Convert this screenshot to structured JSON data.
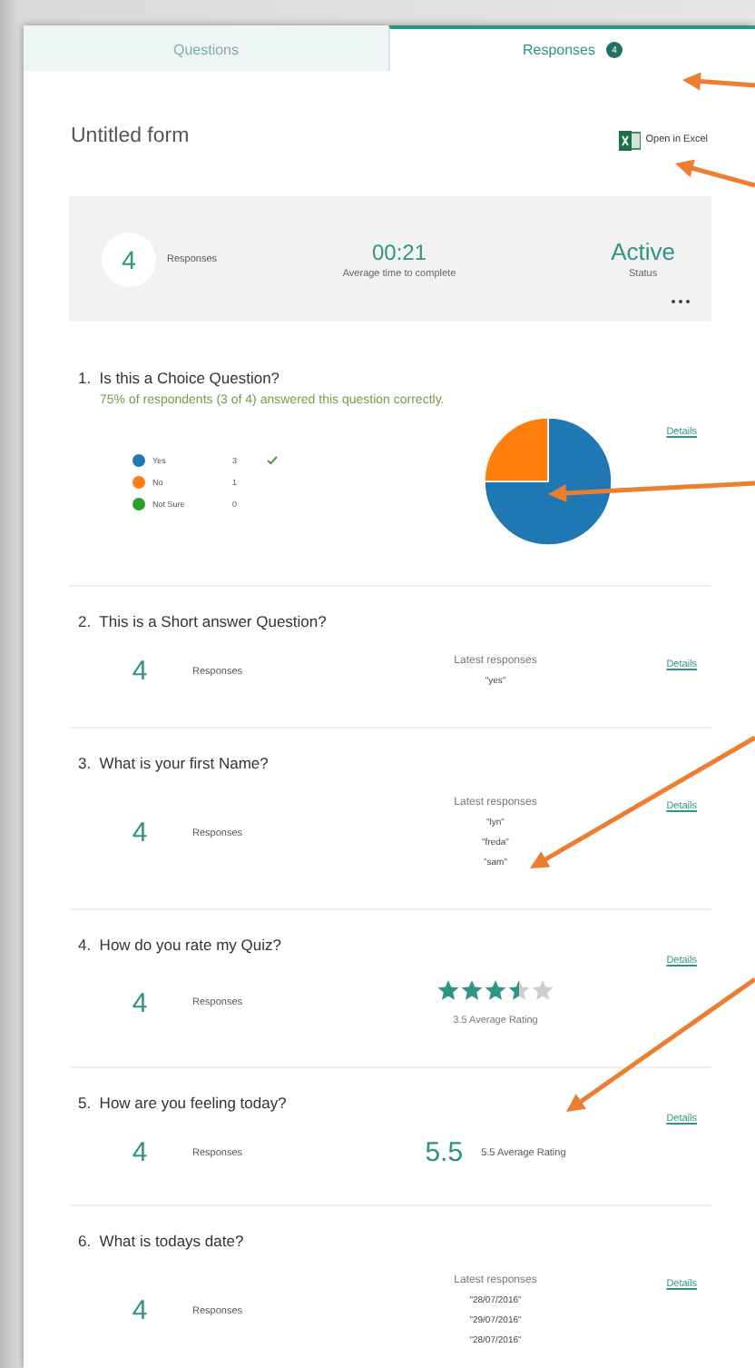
{
  "tabs": [
    {
      "label": "Questions",
      "selected": false
    },
    {
      "label": "Responses",
      "selected": true,
      "badge": "4"
    }
  ],
  "form": {
    "title": "Untitled form",
    "excel_link": "Open in Excel"
  },
  "summary": {
    "count": "4",
    "count_label": "Responses",
    "avg_time": "00:21",
    "avg_time_label": "Average time to complete",
    "status": "Active",
    "status_label": "Status"
  },
  "questions": [
    {
      "kind": "choice",
      "number": "1.",
      "title": "Is this a Choice Question?",
      "note": "75% of respondents (3 of 4) answered this question correctly.",
      "details": "Details",
      "options": [
        {
          "count": "3",
          "color": "#1f77b4",
          "correct": true
        },
        {
          "count": "1",
          "color": "#ff7f0e",
          "correct": false
        },
        {
          "count": "0",
          "color": "#2ca02c",
          "correct": false
        }
      ],
      "chart_data": {
        "type": "pie",
        "categories": [
          "Yes",
          "No",
          "Not Sure"
        ],
        "values": [
          75,
          25,
          0
        ]
      }
    },
    {
      "kind": "text",
      "number": "2.",
      "title": "This is a Short answer Question?",
      "details": "Details",
      "count": "4",
      "count_label": "Responses",
      "latest_label": "Latest responses",
      "responses": [
        "\"yes\""
      ]
    },
    {
      "kind": "text",
      "number": "3.",
      "title": "What is your first Name?",
      "details": "Details",
      "count": "4",
      "count_label": "Responses",
      "latest_label": "Latest responses",
      "responses": [
        "\"lyn\"",
        "\"freda\"",
        "\"sam\""
      ]
    },
    {
      "kind": "rating",
      "number": "4.",
      "title": "How do you rate my Quiz?",
      "details": "Details",
      "count": "4",
      "count_label": "Responses",
      "stars": 3.5,
      "rating_label": "3.5 Average Rating"
    },
    {
      "kind": "number",
      "number": "5.",
      "title": "How are you feeling today?",
      "details": "Details",
      "count": "4",
      "count_label": "Responses",
      "average": "5.5",
      "average_label": "5.5 Average Rating"
    },
    {
      "kind": "text",
      "number": "6.",
      "title": "What is todays date?",
      "details": "Details",
      "count": "4",
      "count_label": "Responses",
      "latest_label": "Latest responses",
      "responses": [
        "\"28/07/2016\"",
        "\"29/07/2016\"",
        "\"28/07/2016\""
      ]
    }
  ]
}
